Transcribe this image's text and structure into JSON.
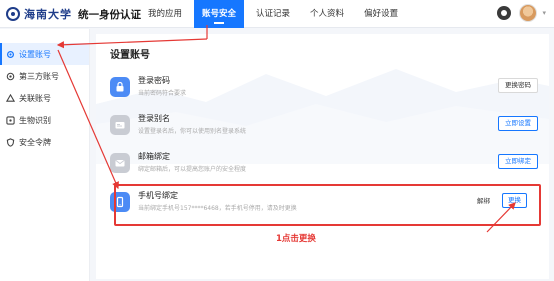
{
  "header": {
    "logo_text": "海南大学",
    "system_title": "统一身份认证",
    "nav": [
      {
        "label": "我的应用",
        "active": false
      },
      {
        "label": "账号安全",
        "active": true
      },
      {
        "label": "认证记录",
        "active": false
      },
      {
        "label": "个人资料",
        "active": false
      },
      {
        "label": "偏好设置",
        "active": false
      }
    ],
    "theme_icon": "theme-toggle-icon",
    "avatar_icon": "user-avatar",
    "user_name": "",
    "caret": "▾"
  },
  "sidebar": {
    "items": [
      {
        "label": "设置账号",
        "icon": "gear-icon",
        "active": true
      },
      {
        "label": "第三方账号",
        "icon": "link-icon",
        "active": false
      },
      {
        "label": "关联账号",
        "icon": "people-icon",
        "active": false
      },
      {
        "label": "生物识别",
        "icon": "face-scan-icon",
        "active": false
      },
      {
        "label": "安全令牌",
        "icon": "shield-icon",
        "active": false
      }
    ]
  },
  "main": {
    "title": "设置账号",
    "rows": [
      {
        "title": "登录密码",
        "desc": "当前密码符合要求",
        "button": "更换密码",
        "button_style": "default",
        "icon": "lock-icon",
        "icon_color": "#4c8bf5"
      },
      {
        "title": "登录别名",
        "desc": "设置登录名后，你可以使用别名登录系统",
        "button": "立即设置",
        "button_style": "blue",
        "icon": "id-card-icon",
        "icon_color": "#c9ccd3"
      },
      {
        "title": "邮箱绑定",
        "desc": "绑定邮箱后，可以提高您账户的安全程度",
        "button": "立即绑定",
        "button_style": "blue",
        "icon": "mail-icon",
        "icon_color": "#c9ccd3"
      }
    ],
    "phone": {
      "title": "手机号绑定",
      "desc": "当前绑定手机号157****6468，若手机号停用，请及时更换",
      "unbind": "解绑",
      "change": "更换",
      "icon": "phone-icon",
      "icon_color": "#4c8bf5"
    }
  },
  "annotation": {
    "text": "1点击更换",
    "color": "#e53935"
  },
  "colors": {
    "accent": "#1677ff",
    "highlight": "#e53935"
  }
}
